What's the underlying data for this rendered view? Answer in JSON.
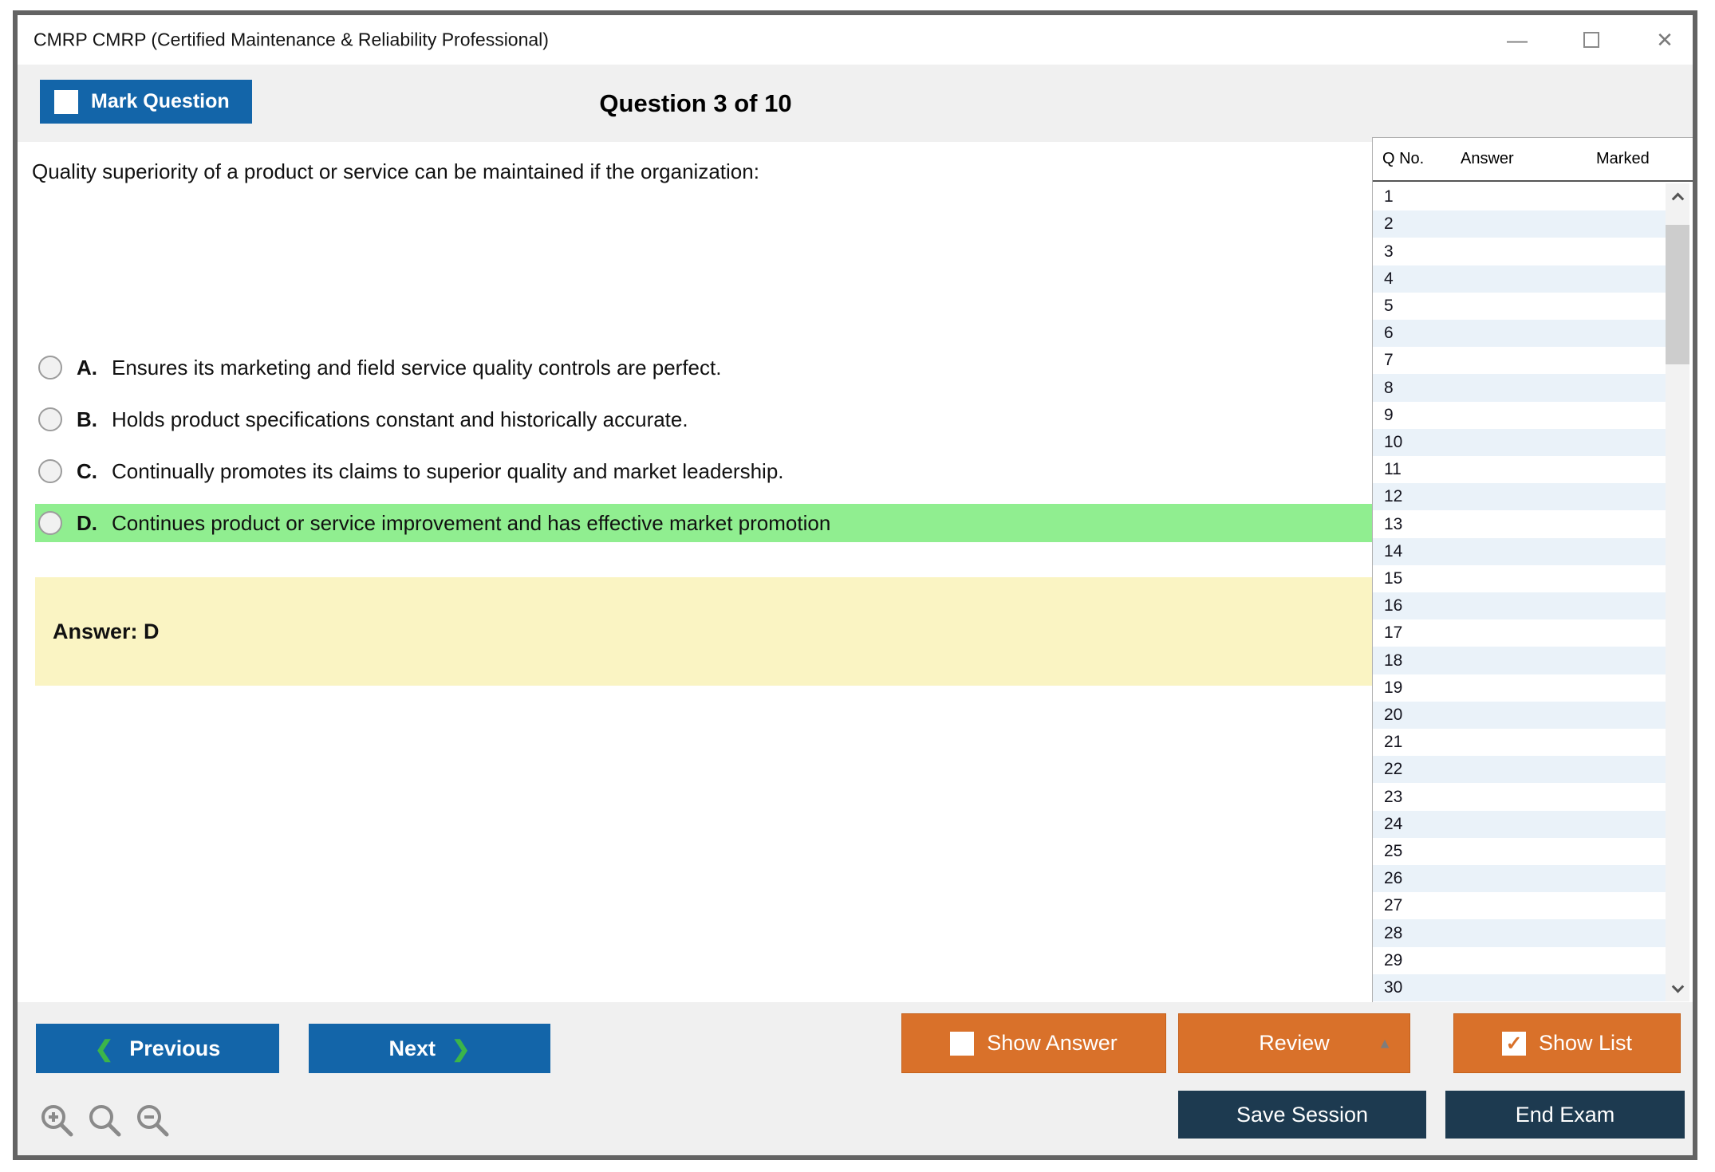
{
  "window": {
    "title": "CMRP CMRP (Certified Maintenance & Reliability Professional)",
    "minimize_glyph": "—",
    "close_glyph": "✕"
  },
  "toolbar": {
    "mark_question_label": "Mark Question",
    "question_counter": "Question 3 of 10"
  },
  "question": {
    "text": "Quality superiority of a product or service can be maintained if the organization:",
    "highlight_index": 3,
    "options": [
      {
        "letter": "A.",
        "text": "Ensures its marketing and field service quality controls are perfect."
      },
      {
        "letter": "B.",
        "text": "Holds product specifications constant and historically accurate."
      },
      {
        "letter": "C.",
        "text": "Continually promotes its claims to superior quality and market leadership."
      },
      {
        "letter": "D.",
        "text": "Continues product or service improvement and has effective market promotion"
      }
    ],
    "answer_label": "Answer: D"
  },
  "sidebar": {
    "columns": {
      "qno": "Q No.",
      "answer": "Answer",
      "marked": "Marked"
    },
    "rows": [
      {
        "q": "1",
        "answer": "",
        "marked": ""
      },
      {
        "q": "2",
        "answer": "",
        "marked": ""
      },
      {
        "q": "3",
        "answer": "",
        "marked": ""
      },
      {
        "q": "4",
        "answer": "",
        "marked": ""
      },
      {
        "q": "5",
        "answer": "",
        "marked": ""
      },
      {
        "q": "6",
        "answer": "",
        "marked": ""
      },
      {
        "q": "7",
        "answer": "",
        "marked": ""
      },
      {
        "q": "8",
        "answer": "",
        "marked": ""
      },
      {
        "q": "9",
        "answer": "",
        "marked": ""
      },
      {
        "q": "10",
        "answer": "",
        "marked": ""
      },
      {
        "q": "11",
        "answer": "",
        "marked": ""
      },
      {
        "q": "12",
        "answer": "",
        "marked": ""
      },
      {
        "q": "13",
        "answer": "",
        "marked": ""
      },
      {
        "q": "14",
        "answer": "",
        "marked": ""
      },
      {
        "q": "15",
        "answer": "",
        "marked": ""
      },
      {
        "q": "16",
        "answer": "",
        "marked": ""
      },
      {
        "q": "17",
        "answer": "",
        "marked": ""
      },
      {
        "q": "18",
        "answer": "",
        "marked": ""
      },
      {
        "q": "19",
        "answer": "",
        "marked": ""
      },
      {
        "q": "20",
        "answer": "",
        "marked": ""
      },
      {
        "q": "21",
        "answer": "",
        "marked": ""
      },
      {
        "q": "22",
        "answer": "",
        "marked": ""
      },
      {
        "q": "23",
        "answer": "",
        "marked": ""
      },
      {
        "q": "24",
        "answer": "",
        "marked": ""
      },
      {
        "q": "25",
        "answer": "",
        "marked": ""
      },
      {
        "q": "26",
        "answer": "",
        "marked": ""
      },
      {
        "q": "27",
        "answer": "",
        "marked": ""
      },
      {
        "q": "28",
        "answer": "",
        "marked": ""
      },
      {
        "q": "29",
        "answer": "",
        "marked": ""
      },
      {
        "q": "30",
        "answer": "",
        "marked": ""
      }
    ]
  },
  "footer": {
    "previous_label": "Previous",
    "next_label": "Next",
    "show_answer_label": "Show Answer",
    "review_label": "Review",
    "show_list_label": "Show List",
    "save_session_label": "Save Session",
    "end_exam_label": "End Exam",
    "prev_chevron": "❮",
    "next_chevron": "❯",
    "review_caret": "▲"
  },
  "checkboxes": {
    "mark_question_checked": false,
    "show_answer_checked": false,
    "show_list_checked": true,
    "check_glyph": "✓"
  },
  "icons": {
    "zoom_in": "zoom-in-icon",
    "zoom_reset": "zoom-icon",
    "zoom_out": "zoom-out-icon"
  },
  "colors": {
    "accent_blue": "#1365A9",
    "accent_orange": "#D9712A",
    "accent_navy": "#1D3A50",
    "highlight_green": "#90EE90",
    "answer_yellow": "#FAF4C3",
    "chrome_gray": "#F0F0F0",
    "stripe_blue": "#EAF2F9"
  }
}
